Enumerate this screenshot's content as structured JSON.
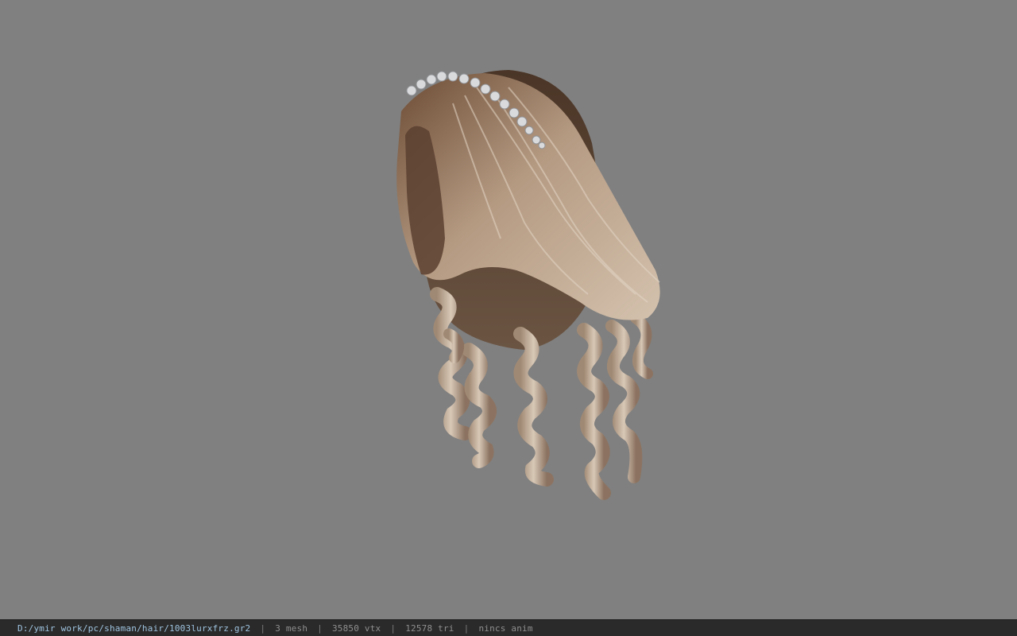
{
  "app": {
    "viewport_background": "#808080",
    "model_name": "hair-model-icon"
  },
  "status_bar": {
    "file_path": "D:/ymir work/pc/shaman/hair/1003lurxfrz.gr2",
    "mesh_count": "3 mesh",
    "vertex_count": "35850 vtx",
    "triangle_count": "12578 tri",
    "anim_state": "nincs anim",
    "separator": "|"
  }
}
